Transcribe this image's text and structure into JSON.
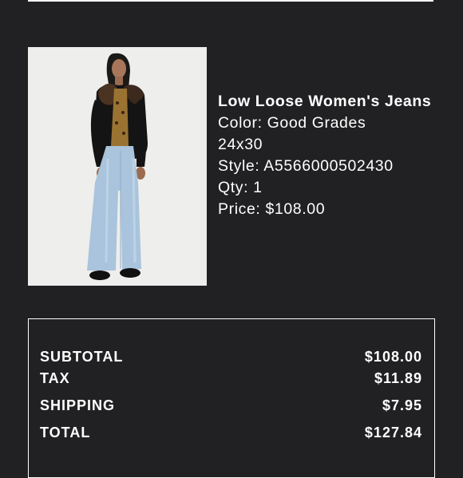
{
  "product": {
    "name": "Low Loose Women's Jeans",
    "color": "Color: Good Grades",
    "size": "24x30",
    "style": "Style: A5566000502430",
    "qty": "Qty: 1",
    "price": "Price: $108.00",
    "image_icon": "product-photo"
  },
  "totals": [
    {
      "label": "SUBTOTAL",
      "value": "$108.00"
    },
    {
      "label": "TAX",
      "value": "$11.89"
    },
    {
      "label": "SHIPPING",
      "value": "$7.95"
    },
    {
      "label": "TOTAL",
      "value": "$127.84"
    }
  ],
  "colors": {
    "background": "#212123",
    "text": "#ffffff",
    "image_background": "#eeeeec"
  }
}
